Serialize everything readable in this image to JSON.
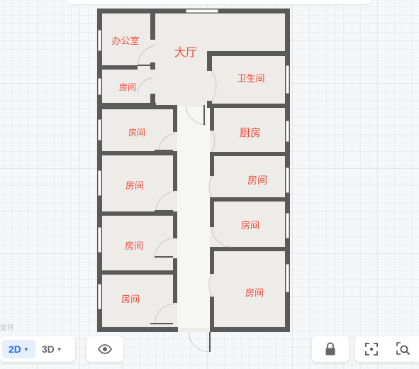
{
  "rooms": {
    "office": "办公室",
    "hall": "大厅",
    "bathroom": "卫生间",
    "room_left_1": "房间",
    "room_left_2": "房间",
    "room_left_3": "房间",
    "room_left_4": "房间",
    "room_left_5": "房间",
    "kitchen": "厨房",
    "room_right_1": "房间",
    "room_right_2": "房间",
    "room_right_3": "房间"
  },
  "watermark_text": "旋转",
  "view_modes": [
    {
      "label": "2D",
      "active": true
    },
    {
      "label": "3D",
      "active": false
    }
  ],
  "icons": {
    "eye": "eye-icon",
    "lock": "lock-icon",
    "focus": "focus-frame-icon",
    "zoom": "zoom-in-icon",
    "caret": "chevron-down-icon"
  },
  "colors": {
    "wall": "#555555",
    "floor": "#eeece8",
    "label": "#f04a3a",
    "accent": "#2f6fe4"
  }
}
